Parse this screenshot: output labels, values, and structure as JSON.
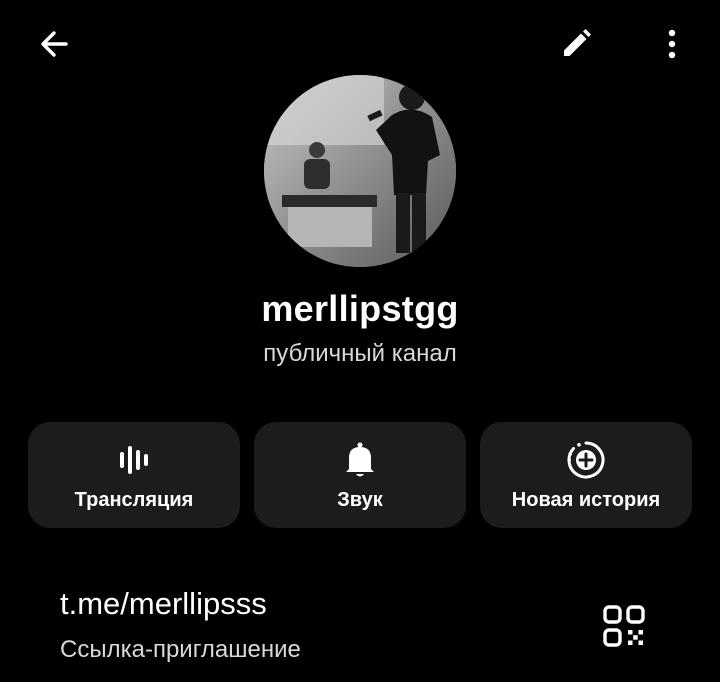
{
  "header": {
    "back_icon": "arrow-left-icon",
    "edit_icon": "pencil-icon",
    "more_icon": "more-vertical-icon"
  },
  "profile": {
    "avatar": "channel-avatar-photo",
    "name": "merllipstgg",
    "type": "публичный канал"
  },
  "actions": [
    {
      "label": "Трансляция",
      "icon": "live-stream-icon"
    },
    {
      "label": "Звук",
      "icon": "bell-icon"
    },
    {
      "label": "Новая история",
      "icon": "add-story-icon"
    }
  ],
  "link": {
    "url": "t.me/merllipsss",
    "caption": "Ссылка-приглашение",
    "qr_icon": "qr-code-icon"
  },
  "colors": {
    "background": "#000000",
    "card": "#1c1c1e",
    "text": "#ffffff",
    "secondary_text": "#d8d8d8"
  }
}
